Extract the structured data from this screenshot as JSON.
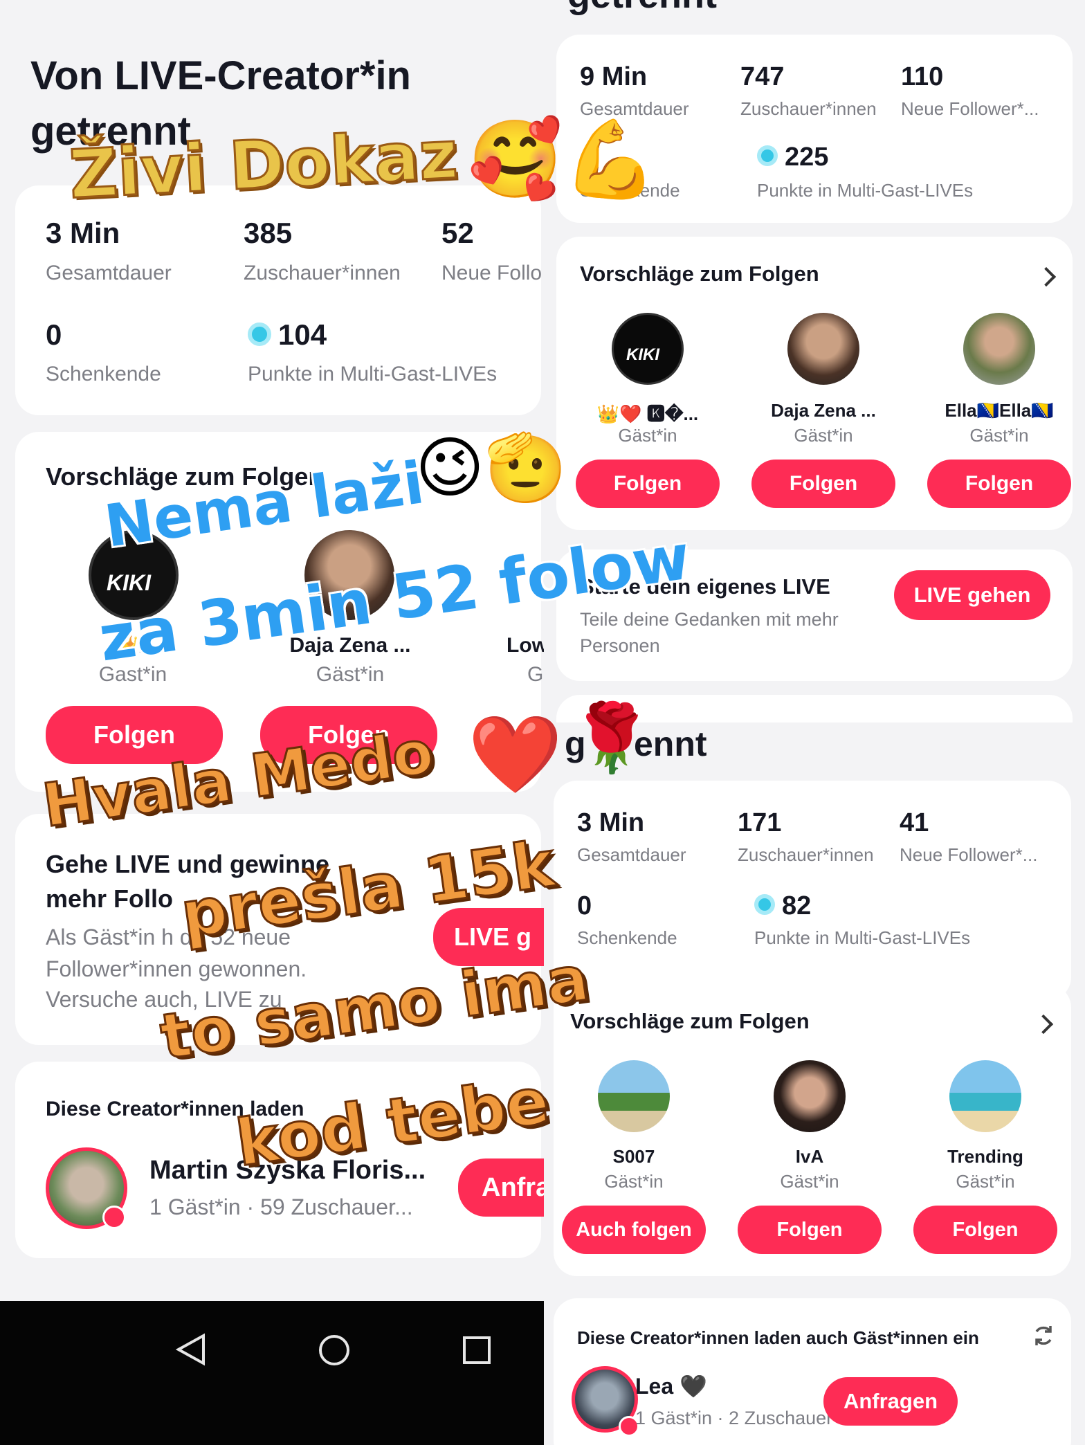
{
  "left": {
    "title": "Von LIVE-Creator*in getrennt",
    "stats": {
      "duration_value": "3 Min",
      "duration_label": "Gesamtdauer",
      "viewers_value": "385",
      "viewers_label": "Zuschauer*innen",
      "followers_value": "52",
      "followers_label": "Neue Follo",
      "gifters_value": "0",
      "gifters_label": "Schenkende",
      "points_value": "104",
      "points_label": "Punkte in Multi-Gast-LIVEs"
    },
    "suggest": {
      "title": "Vorschläge zum Folgen",
      "users": [
        {
          "name": "👑K",
          "role": "Gast*in",
          "button": "Folgen"
        },
        {
          "name": "Daja Zena ...",
          "role": "Gäst*in",
          "button": "Folgen"
        },
        {
          "name": "Low",
          "role": "G",
          "button": ""
        }
      ]
    },
    "golive": {
      "title_line1": "Gehe LIVE und gewinne",
      "title_line2": "mehr Follo",
      "desc_line1": "Als Gäst*in h     du 52 neue",
      "desc_line2": "Follower*innen gewonnen.",
      "desc_line3": "Versuche auch, LIVE zu",
      "button": "LIVE g"
    },
    "invite": {
      "title": "Diese Creator*innen laden",
      "name": "Martin Szyska Floris...",
      "meta": "1 Gäst*in · 59 Zuschauer...",
      "button": "Anfra"
    }
  },
  "right_top": {
    "header_fragment": "getrennt",
    "stats": {
      "duration_value": "9 Min",
      "duration_label": "Gesamtdauer",
      "viewers_value": "747",
      "viewers_label": "Zuschauer*innen",
      "followers_value": "110",
      "followers_label": "Neue Follower*...",
      "gifters_label": "Schenkende",
      "points_value": "225",
      "points_label": "Punkte in Multi-Gast-LIVEs"
    },
    "suggest": {
      "title": "Vorschläge zum Folgen",
      "users": [
        {
          "name": "👑❤️ 🅺�...",
          "role": "Gäst*in",
          "button": "Folgen"
        },
        {
          "name": "Daja Zena ...",
          "role": "Gäst*in",
          "button": "Folgen"
        },
        {
          "name": "Ella🇧🇦Ella🇧🇦",
          "role": "Gäst*in",
          "button": "Folgen"
        }
      ]
    },
    "start_live": {
      "title": "Starte dein eigenes LIVE",
      "desc_line1": "Teile deine Gedanken mit mehr",
      "desc_line2": "Personen",
      "button": "LIVE gehen"
    }
  },
  "right_bottom": {
    "header_fragment": "g     ennt",
    "stats": {
      "duration_value": "3 Min",
      "duration_label": "Gesamtdauer",
      "viewers_value": "171",
      "viewers_label": "Zuschauer*innen",
      "followers_value": "41",
      "followers_label": "Neue Follower*...",
      "gifters_value": "0",
      "gifters_label": "Schenkende",
      "points_value": "82",
      "points_label": "Punkte in Multi-Gast-LIVEs"
    },
    "suggest": {
      "title": "Vorschläge zum Folgen",
      "users": [
        {
          "name": "S007",
          "role": "Gäst*in",
          "button": "Auch folgen"
        },
        {
          "name": "IᴠA",
          "role": "Gäst*in",
          "button": "Folgen"
        },
        {
          "name": "Trending",
          "role": "Gäst*in",
          "button": "Folgen"
        }
      ]
    },
    "invite": {
      "title": "Diese Creator*innen laden auch Gäst*innen ein",
      "name": "Lea 🖤",
      "meta": "1 Gäst*in · 2 Zuschauer*...",
      "button": "Anfragen"
    }
  },
  "overlay": {
    "zivi": "Živi Dokaz",
    "zivi_emoji": "🥰💪",
    "nema": "Nema laži",
    "nema_emoji": "😉🫡",
    "za": "za 3min 52 folow",
    "hvala": "Hvala Medo",
    "hvala_emoji": "❤️",
    "presla": "prešla 15k",
    "to_samo": "to samo ima",
    "kod_tebe": "kod tebe",
    "rose": "🌹"
  },
  "navbar": {
    "back_icon": "back-triangle-icon",
    "home_icon": "home-circle-icon",
    "recents_icon": "recents-square-icon"
  }
}
